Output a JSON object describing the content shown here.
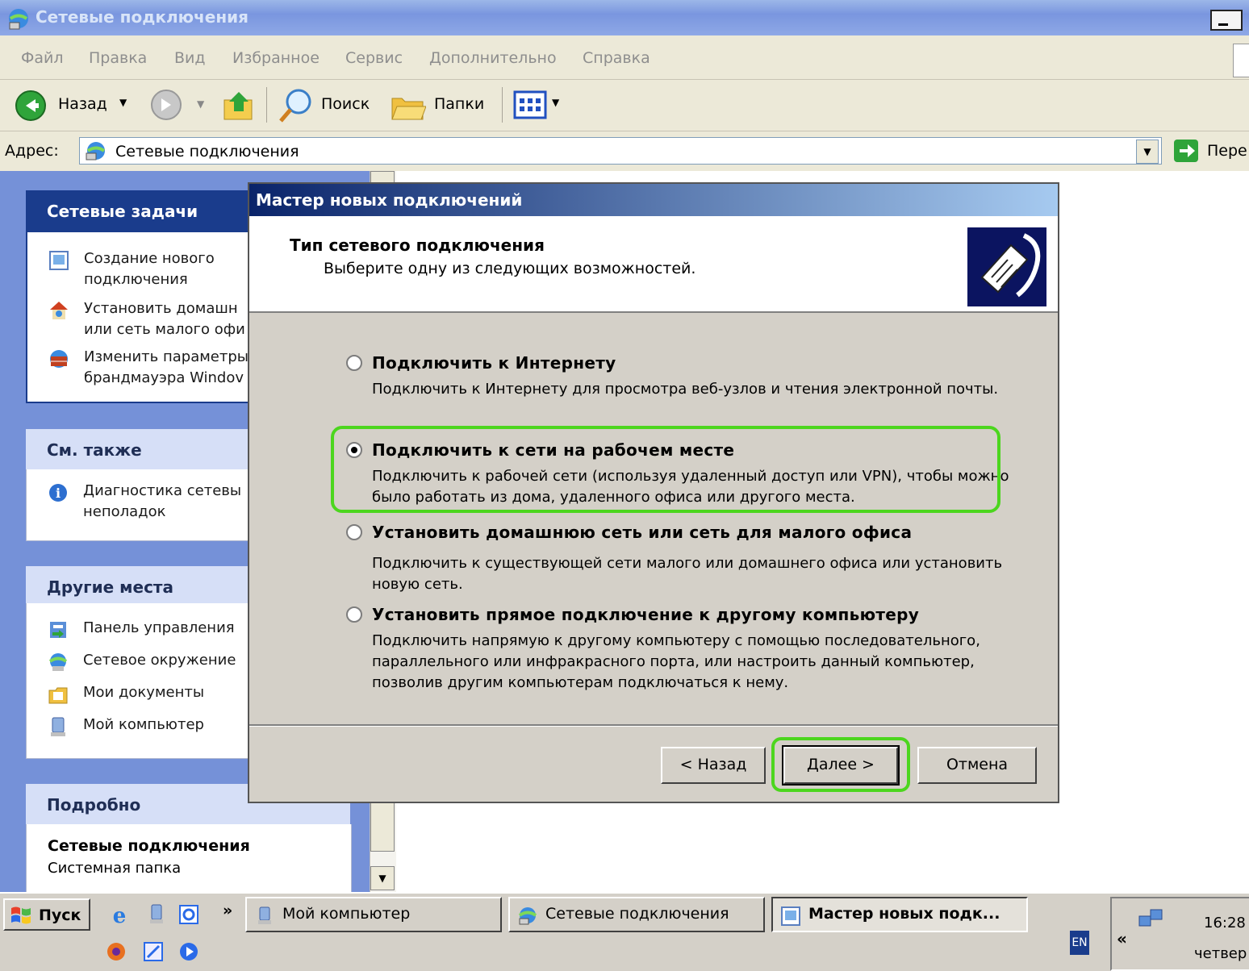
{
  "window": {
    "title": "Сетевые подключения"
  },
  "menubar": [
    "Файл",
    "Правка",
    "Вид",
    "Избранное",
    "Сервис",
    "Дополнительно",
    "Справка"
  ],
  "toolbar": {
    "back": "Назад",
    "search": "Поиск",
    "folders": "Папки"
  },
  "address": {
    "label": "Адрес:",
    "value": "Сетевые подключения",
    "go": "Пере"
  },
  "panes": {
    "tasks": {
      "title": "Сетевые задачи",
      "items": [
        "Создание нового",
        "подключения",
        "Установить домашн",
        "или сеть малого офи",
        "Изменить параметры",
        "брандмауэра Windov"
      ]
    },
    "see_also": {
      "title": "См. также",
      "items": [
        "Диагностика сетевы",
        "неполадок"
      ]
    },
    "other": {
      "title": "Другие места",
      "items": [
        "Панель управления",
        "Сетевое окружение",
        "Мои документы",
        "Мой компьютер"
      ]
    },
    "details": {
      "title": "Подробно",
      "name": "Сетевые подключения",
      "type": "Системная папка"
    }
  },
  "dialog": {
    "title": "Мастер новых подключений",
    "header_title": "Тип сетевого подключения",
    "header_sub": "Выберите одну из следующих возможностей.",
    "options": [
      {
        "title": "Подключить к Интернету",
        "desc": "Подключить к Интернету для просмотра веб-узлов и чтения  электронной почты.",
        "selected": false
      },
      {
        "title": "Подключить к сети на рабочем месте",
        "desc": "Подключить к рабочей сети (используя удаленный доступ или VPN), чтобы можно было работать из дома, удаленного офиса или другого места.",
        "selected": true
      },
      {
        "title": "Установить домашнюю сеть или сеть для малого офиса",
        "desc": "Подключить к существующей сети малого или домашнего офиса или установить новую сеть.",
        "selected": false
      },
      {
        "title": "Установить прямое подключение к другому компьютеру",
        "desc": "Подключить напрямую к другому компьютеру с помощью последовательного, параллельного или инфракрасного порта, или настроить данный компьютер, позволив другим  компьютерам подключаться к нему.",
        "selected": false
      }
    ],
    "buttons": {
      "back": "< Назад",
      "next": "Далее >",
      "cancel": "Отмена"
    }
  },
  "taskbar": {
    "start": "Пуск",
    "more": "»",
    "tasks": [
      "Мой компьютер",
      "Сетевые подключения",
      "Мастер новых подк..."
    ],
    "lang": "EN",
    "tray_arrow": "«",
    "time": "16:28",
    "day": "четвер"
  },
  "colors": {
    "highlight": "#4cd61e",
    "dialog_title_start": "#0a246a",
    "dialog_title_end": "#a6caf0"
  }
}
